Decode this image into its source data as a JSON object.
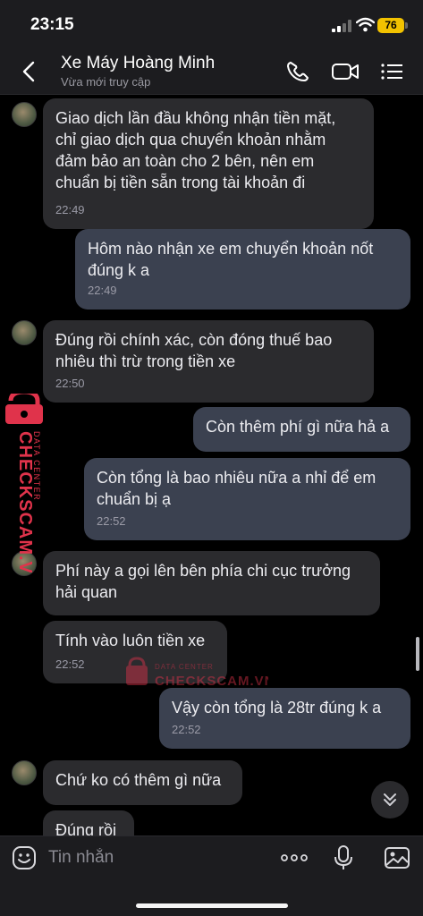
{
  "status_bar": {
    "time": "23:15",
    "battery": "76"
  },
  "header": {
    "title": "Xe Máy Hoàng Minh",
    "subtitle": "Vừa mới truy cập"
  },
  "messages": [
    {
      "lines": [
        "Giao dịch lần đầu không nhận tiền mặt,",
        "chỉ giao dịch qua chuyển khoản nhằm",
        "đảm bảo an toàn cho 2 bên, nên em",
        "chuẩn bị tiền sẵn trong tài khoản đi"
      ],
      "time": "22:49"
    },
    {
      "lines": [
        "Hôm nào nhận xe em chuyển khoản nốt",
        "đúng k a"
      ],
      "time": "22:49"
    },
    {
      "lines": [
        "Đúng rồi chính xác, còn đóng thuế bao",
        "nhiêu thì trừ trong tiền xe"
      ],
      "time": "22:50"
    },
    {
      "lines": [
        "Còn thêm phí gì nữa hả a"
      ]
    },
    {
      "lines": [
        "Còn tổng là bao nhiêu nữa a nhỉ để em",
        "chuẩn bị ạ"
      ],
      "time": "22:52"
    },
    {
      "lines": [
        "Phí này a gọi lên bên phía chi cục trưởng",
        "hải quan"
      ]
    },
    {
      "lines": [
        "Tính vào luôn tiền xe"
      ],
      "time": "22:52"
    },
    {
      "lines": [
        "Vậy còn tổng là 28tr đúng k a"
      ],
      "time": "22:52"
    },
    {
      "lines": [
        "Chứ ko có thêm gì nữa"
      ]
    },
    {
      "lines": [
        "Đúng rồi"
      ]
    }
  ],
  "watermark": {
    "brand": "CHECKSCAM.VN",
    "tag": "DATA CENTER"
  },
  "composer": {
    "placeholder": "Tin nhắn"
  },
  "icons": [
    "back-chevron-icon",
    "phone-icon",
    "video-call-icon",
    "menu-list-icon",
    "emoji-icon",
    "more-icon",
    "microphone-icon",
    "image-icon",
    "chevron-down-icon",
    "padlock-icon"
  ],
  "colors": {
    "incoming_bubble": "#2b2b2e",
    "outgoing_bubble": "#3b4150",
    "background": "#000000",
    "watermark": "#e0334b"
  }
}
